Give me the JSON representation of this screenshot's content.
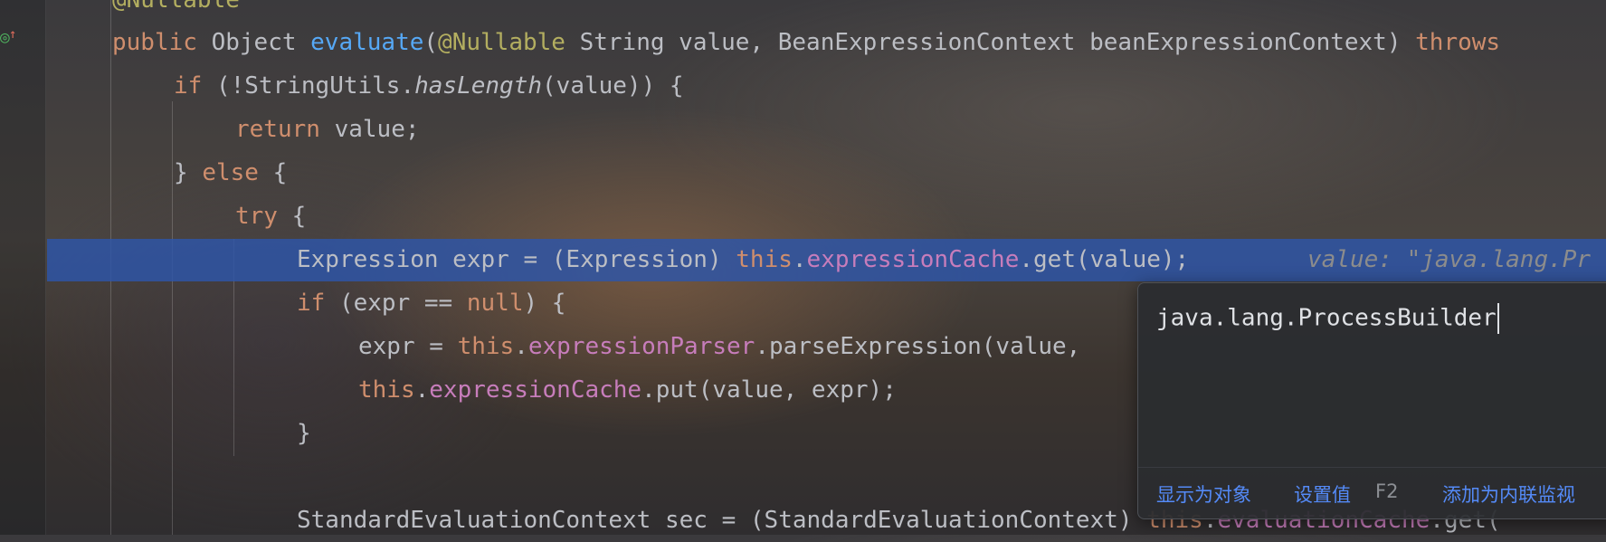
{
  "editor": {
    "lines": [
      {
        "tokens": [
          {
            "t": "@Nullable",
            "c": "ann"
          }
        ]
      },
      {
        "tokens": [
          {
            "t": "public ",
            "c": "kw"
          },
          {
            "t": "Object ",
            "c": "txt"
          },
          {
            "t": "evaluate",
            "c": "fn"
          },
          {
            "t": "(",
            "c": "txt"
          },
          {
            "t": "@Nullable ",
            "c": "ann"
          },
          {
            "t": "String value, BeanExpressionContext beanExpressionContext) ",
            "c": "txt"
          },
          {
            "t": "throws",
            "c": "kw"
          }
        ]
      },
      {
        "tokens": [
          {
            "t": "if ",
            "c": "kw"
          },
          {
            "t": "(!StringUtils.",
            "c": "txt"
          },
          {
            "t": "hasLength",
            "c": "mth"
          },
          {
            "t": "(value)) {",
            "c": "txt"
          }
        ]
      },
      {
        "tokens": [
          {
            "t": "return ",
            "c": "kw"
          },
          {
            "t": "value;",
            "c": "txt"
          }
        ]
      },
      {
        "tokens": [
          {
            "t": "} ",
            "c": "txt"
          },
          {
            "t": "else ",
            "c": "kw"
          },
          {
            "t": "{",
            "c": "txt"
          }
        ]
      },
      {
        "tokens": [
          {
            "t": "try ",
            "c": "kw"
          },
          {
            "t": "{",
            "c": "txt"
          }
        ]
      },
      {
        "tokens": [
          {
            "t": "Expression expr = (Expression) ",
            "c": "txt"
          },
          {
            "t": "this",
            "c": "kw"
          },
          {
            "t": ".",
            "c": "txt"
          },
          {
            "t": "expressionCache",
            "c": "fld"
          },
          {
            "t": ".get(value);",
            "c": "txt"
          }
        ]
      },
      {
        "tokens": [
          {
            "t": "if ",
            "c": "kw"
          },
          {
            "t": "(expr == ",
            "c": "txt"
          },
          {
            "t": "null",
            "c": "kw"
          },
          {
            "t": ") {",
            "c": "txt"
          }
        ]
      },
      {
        "tokens": [
          {
            "t": "expr = ",
            "c": "txt"
          },
          {
            "t": "this",
            "c": "kw"
          },
          {
            "t": ".",
            "c": "txt"
          },
          {
            "t": "expressionParser",
            "c": "fld"
          },
          {
            "t": ".parseExpression(value,",
            "c": "txt"
          }
        ]
      },
      {
        "tokens": [
          {
            "t": "this",
            "c": "kw"
          },
          {
            "t": ".",
            "c": "txt"
          },
          {
            "t": "expressionCache",
            "c": "fld"
          },
          {
            "t": ".put(value, expr);",
            "c": "txt"
          }
        ]
      },
      {
        "tokens": [
          {
            "t": "}",
            "c": "txt"
          }
        ]
      },
      {
        "tokens": []
      },
      {
        "tokens": [
          {
            "t": "StandardEvaluationContext sec = (StandardEvaluationContext) ",
            "c": "txt"
          },
          {
            "t": "this",
            "c": "kw"
          },
          {
            "t": ".",
            "c": "txt"
          },
          {
            "t": "evaluationCache",
            "c": "fld"
          },
          {
            "t": ".get(",
            "c": "txt"
          }
        ]
      }
    ],
    "inline_value": "value: \"java.lang.Pr"
  },
  "popup": {
    "value": "java.lang.ProcessBuilder",
    "show_as_object": "显示为对象",
    "set_value": "设置值",
    "set_value_shortcut": "F2",
    "add_inline_watch": "添加为内联监视"
  },
  "colors": {
    "keyword": "#cf8e6d",
    "function": "#56a8f5",
    "annotation": "#b3ae60",
    "field": "#c77dbb",
    "text": "#bcbec4",
    "highlight": "#2d55aa",
    "link": "#548af7"
  },
  "icons": {
    "gutter": "override-method-icon"
  }
}
